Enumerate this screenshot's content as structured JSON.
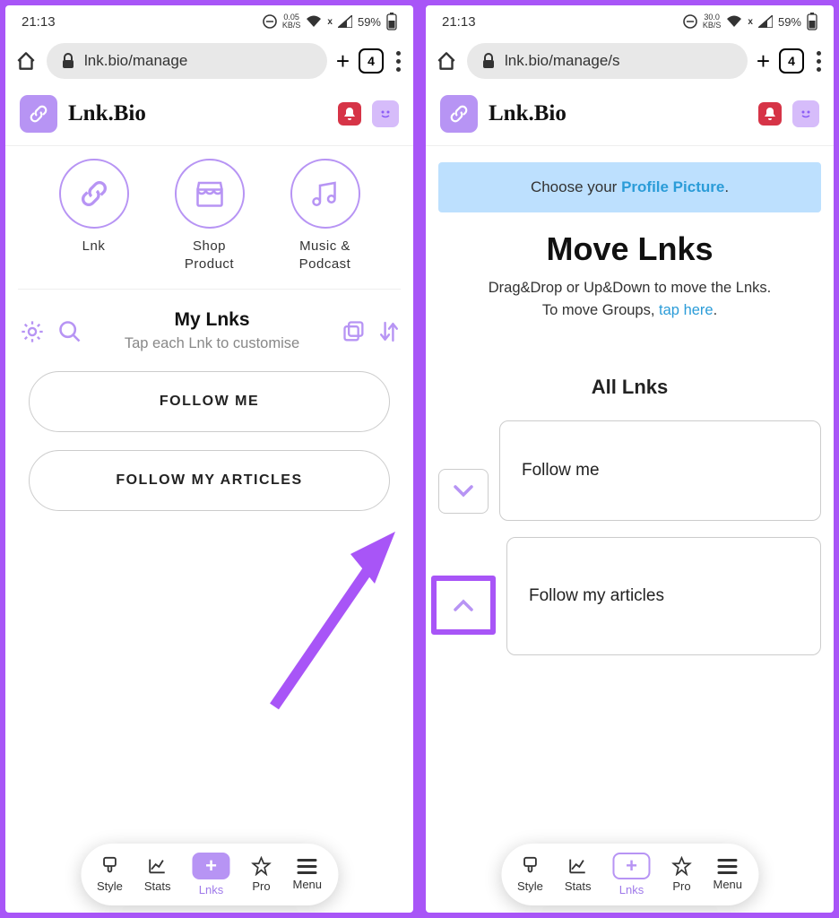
{
  "status": {
    "time": "21:13",
    "speed1": "0.05",
    "speed2": "30.0",
    "speed_unit": "KB/S",
    "battery": "59%"
  },
  "browser": {
    "url1": "lnk.bio/manage",
    "url2": "lnk.bio/manage/s",
    "tabs": "4"
  },
  "brand": "Lnk.Bio",
  "notif": "!",
  "cats": [
    {
      "label": "Lnk"
    },
    {
      "label": "Shop\nProduct"
    },
    {
      "label": "Music &\nPodcast"
    }
  ],
  "mylinks": {
    "title": "My Lnks",
    "sub": "Tap each Lnk to customise"
  },
  "links": [
    "FOLLOW ME",
    "FOLLOW MY ARTICLES"
  ],
  "nav": {
    "style": "Style",
    "stats": "Stats",
    "lnks": "Lnks",
    "pro": "Pro",
    "menu": "Menu"
  },
  "banner": {
    "pre": "Choose your ",
    "link": "Profile Picture",
    "post": "."
  },
  "move": {
    "title": "Move Lnks",
    "sub1": "Drag&Drop or Up&Down to move the Lnks.",
    "sub2_pre": "To move Groups, ",
    "sub2_link": "tap here",
    "sub2_post": "."
  },
  "all": {
    "title": "All Lnks",
    "items": [
      "Follow me",
      "Follow my articles"
    ]
  }
}
